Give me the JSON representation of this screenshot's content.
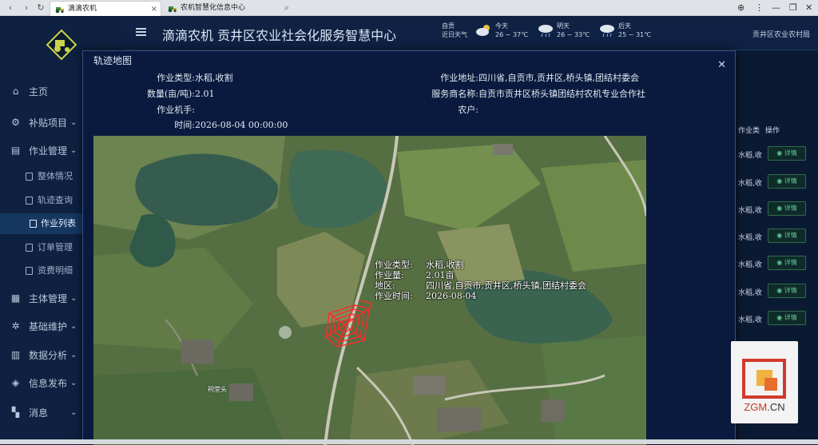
{
  "browser": {
    "tabs": [
      {
        "label": "滴滴农机",
        "active": true
      },
      {
        "label": "农机智慧化信息中心",
        "active": false
      }
    ]
  },
  "header": {
    "title": "滴滴农机 贡井区农业社会化服务智慧中心",
    "weather": [
      {
        "title": "自贡",
        "range": "近日天气"
      },
      {
        "title": "今天",
        "range": "26 ~ 37℃"
      },
      {
        "title": "明天",
        "range": "26 ~ 33℃"
      },
      {
        "title": "后天",
        "range": "25 ~ 31℃"
      }
    ],
    "org": "贡井区农业农村局"
  },
  "sidebar": {
    "items": [
      {
        "label": "主页",
        "icon": "home-icon"
      },
      {
        "label": "补贴项目",
        "icon": "gear-icon"
      },
      {
        "label": "作业管理",
        "icon": "doc-icon"
      },
      {
        "label": "整体情况"
      },
      {
        "label": "轨迹查询"
      },
      {
        "label": "作业列表",
        "active": true
      },
      {
        "label": "订单管理"
      },
      {
        "label": "资费明细"
      },
      {
        "label": "主体管理",
        "icon": "building-icon"
      },
      {
        "label": "基础维护",
        "icon": "cog-icon"
      },
      {
        "label": "数据分析",
        "icon": "chart-icon"
      },
      {
        "label": "信息发布",
        "icon": "megaphone-icon"
      },
      {
        "label": "消息",
        "icon": "grid-icon"
      }
    ]
  },
  "table": {
    "headers": [
      "作业类",
      "操作"
    ],
    "rows": [
      "水稻,收",
      "水稻,收",
      "水稻,收",
      "水稻,收",
      "水稻,收",
      "水稻,收",
      "水稻,收"
    ],
    "action": "详情"
  },
  "modal": {
    "title": "轨迹地图",
    "fields": {
      "job_type_label": "作业类型:",
      "job_type": "水稻,收割",
      "qty_label": "数量(亩/吨):",
      "qty": "2.01",
      "machine_label": "作业机手:",
      "machine": "",
      "time_label": "时间:",
      "time": "2026-08-04 00:00:00",
      "addr_label": "作业地址:",
      "addr": "四川省,自贡市,贡井区,桥头镇,团结村委会",
      "provider_label": "服务商名称:",
      "provider": "自贡市贡井区桥头镇团结村农机专业合作社",
      "farmer_label": "农户:",
      "farmer": ""
    },
    "map_popup": {
      "type_label": "作业类型:",
      "type": "水稻,收割",
      "qty_label": "作业量:",
      "qty": "2.01亩",
      "area_label": "地区:",
      "area": "四川省,自贡市,贡井区,桥头镇,团结村委会",
      "time_label": "作业时间:",
      "time": "2026-08-04"
    },
    "place_label": "祠堂头",
    "track_color": "#ff2a2a"
  },
  "watermark": {
    "text_red": "ZGM",
    "text_dark": ".CN"
  }
}
